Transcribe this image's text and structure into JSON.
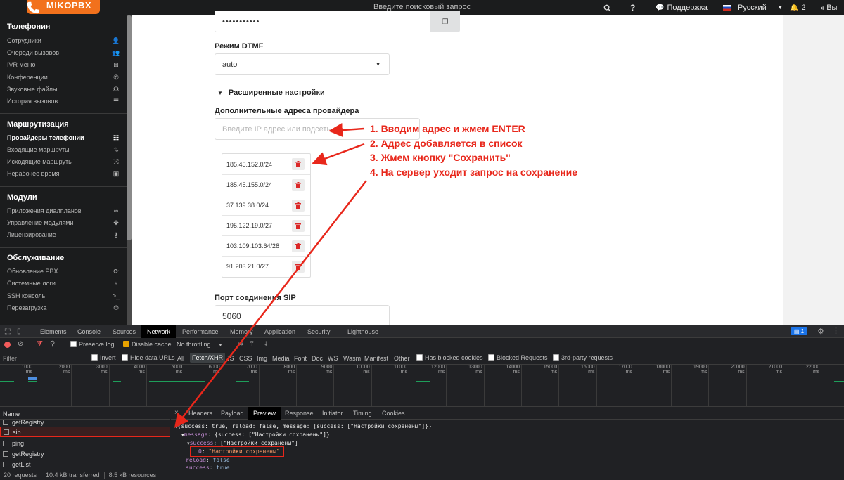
{
  "topbar": {
    "logo_text": "MIKOPBX",
    "search_placeholder": "Введите поисковый запрос",
    "help_icon": "question-icon",
    "support_label": "Поддержка",
    "language_label": "Русский",
    "notifications_count": "2",
    "logout_label": "Вы"
  },
  "sidebar": {
    "sections": [
      {
        "title": "Телефония",
        "items": [
          {
            "label": "Сотрудники",
            "icon": "user-icon"
          },
          {
            "label": "Очереди вызовов",
            "icon": "users-icon"
          },
          {
            "label": "IVR меню",
            "icon": "sitemap-icon"
          },
          {
            "label": "Конференции",
            "icon": "phone-volume-icon"
          },
          {
            "label": "Звуковые файлы",
            "icon": "headphones-icon"
          },
          {
            "label": "История вызовов",
            "icon": "list-icon"
          }
        ]
      },
      {
        "title": "Маршрутизация",
        "items": [
          {
            "label": "Провайдеры телефонии",
            "icon": "server-icon",
            "active": true
          },
          {
            "label": "Входящие маршруты",
            "icon": "incoming-icon"
          },
          {
            "label": "Исходящие маршруты",
            "icon": "random-icon"
          },
          {
            "label": "Нерабочее время",
            "icon": "calendar-icon"
          }
        ]
      },
      {
        "title": "Модули",
        "items": [
          {
            "label": "Приложения диалпланов",
            "icon": "infinity-icon"
          },
          {
            "label": "Управление модулями",
            "icon": "puzzle-icon"
          },
          {
            "label": "Лицензирование",
            "icon": "key-icon"
          }
        ]
      },
      {
        "title": "Обслуживание",
        "items": [
          {
            "label": "Обновление PBX",
            "icon": "sync-icon"
          },
          {
            "label": "Системные логи",
            "icon": "stethoscope-icon"
          },
          {
            "label": "SSH консоль",
            "icon": "terminal-icon"
          },
          {
            "label": "Перезагрузка",
            "icon": "power-icon"
          }
        ]
      }
    ]
  },
  "form": {
    "password_value": "•••••••••••",
    "dtmf_label": "Режим DTMF",
    "dtmf_value": "auto",
    "advanced_label": "Расширенные настройки",
    "extra_hosts_label": "Дополнительные адреса провайдера",
    "ip_placeholder": "Введите IP адрес или подсеть",
    "ip_list": [
      "185.45.152.0/24",
      "185.45.155.0/24",
      "37.139.38.0/24",
      "195.122.19.0/27",
      "103.109.103.64/28",
      "91.203.21.0/27"
    ],
    "sip_port_label": "Порт соединения SIP",
    "sip_port_value": "5060"
  },
  "annotations": [
    "1. Вводим адрес и жмем ENTER",
    "2. Адрес добавляется в список",
    "3. Жмем кнопку \"Сохранить\"",
    "4. На сервер уходит запрос на сохранение"
  ],
  "devtools": {
    "tabs": [
      "Elements",
      "Console",
      "Sources",
      "Network",
      "Performance",
      "Memory",
      "Application",
      "Security",
      "Lighthouse"
    ],
    "selected_tab": "Network",
    "badge": "1",
    "toolbar": {
      "preserve_log": "Preserve log",
      "disable_cache": "Disable cache",
      "throttling": "No throttling"
    },
    "filter": {
      "placeholder": "Filter",
      "invert": "Invert",
      "hide_data_urls": "Hide data URLs",
      "types": [
        "All",
        "Fetch/XHR",
        "JS",
        "CSS",
        "Img",
        "Media",
        "Font",
        "Doc",
        "WS",
        "Wasm",
        "Manifest",
        "Other"
      ],
      "selected_type": "Fetch/XHR",
      "blocked_cookies": "Has blocked cookies",
      "blocked_requests": "Blocked Requests",
      "third_party": "3rd-party requests"
    },
    "timeline_ticks": [
      "1000 ms",
      "2000 ms",
      "3000 ms",
      "4000 ms",
      "5000 ms",
      "6000 ms",
      "7000 ms",
      "8000 ms",
      "9000 ms",
      "10000 ms",
      "11000 ms",
      "12000 ms",
      "13000 ms",
      "14000 ms",
      "15000 ms",
      "16000 ms",
      "17000 ms",
      "18000 ms",
      "19000 ms",
      "20000 ms",
      "21000 ms",
      "22000 ms",
      "230"
    ],
    "name_header": "Name",
    "requests": [
      "getRegistry",
      "sip",
      "ping",
      "getRegistry",
      "getList"
    ],
    "selected_request": "sip",
    "status": {
      "requests": "20 requests",
      "transferred": "10.4 kB transferred",
      "resources": "8.5 kB resources"
    },
    "panel_tabs": [
      "Headers",
      "Payload",
      "Preview",
      "Response",
      "Initiator",
      "Timing",
      "Cookies"
    ],
    "selected_panel_tab": "Preview",
    "preview": {
      "line1": "{success: true, reload: false, message: {success: [\"Настройки сохранены\"]}}",
      "line2_key": "message",
      "line2_val": "{success: [\"Настройки сохранены\"]}",
      "line3_key": "success",
      "line3_val": "[\"Настройки сохранены\"]",
      "line4_key": "0",
      "line4_val": "\"Настройки сохранены\"",
      "line5_key": "reload",
      "line5_val": "false",
      "line6_key": "success",
      "line6_val": "true"
    }
  },
  "colors": {
    "accent": "#f2711c",
    "annotation": "#e8271b",
    "trash": "#db2828"
  }
}
